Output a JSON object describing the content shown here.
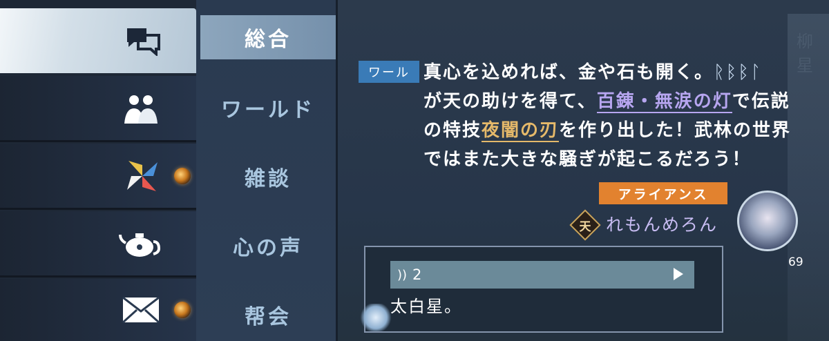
{
  "icon_rail": [
    {
      "id": "chat",
      "icon": "chat-bubbles-icon",
      "active": true,
      "notify": false
    },
    {
      "id": "world",
      "icon": "crowd-icon",
      "active": false,
      "notify": false
    },
    {
      "id": "pinwheel",
      "icon": "pinwheel-icon",
      "active": false,
      "notify": true
    },
    {
      "id": "teapot",
      "icon": "teapot-icon",
      "active": false,
      "notify": false
    },
    {
      "id": "mail",
      "icon": "envelope-icon",
      "active": false,
      "notify": true
    }
  ],
  "channels": [
    "総合",
    "ワールド",
    "雑談",
    "心の声",
    "帮会"
  ],
  "active_channel": "総合",
  "system_message": {
    "badge": "ワール",
    "line1_text": "真心を込めれば、金や石も開く。",
    "line1_rune": "ᚱᛒᛒᛚ",
    "line2_pre": "が天の助けを得て、",
    "line2_highlight": "百錬・無涙の灯",
    "line2_post": "で伝説",
    "line3_pre": "の特技",
    "line3_highlight": "夜闇の刃",
    "line3_post": "を作り出した！武林の世界",
    "line4": "ではまた大きな騒ぎが起こるだろう！"
  },
  "sender": {
    "guild_tag": "アライアンス",
    "title_glyph": "天",
    "name": "れもんめろん",
    "level": "69"
  },
  "chat_bubble": {
    "voice_icon": "))",
    "voice_count": "2",
    "text": "太白星。"
  },
  "bg_deco": {
    "top_right": "柳星"
  },
  "colors": {
    "badge_world": "#3a7bb7",
    "guild_tag": "#e2822f",
    "highlight_item": "#b7a6f0",
    "highlight_skill": "#e5b96a",
    "player_name": "#c7bcf2"
  }
}
